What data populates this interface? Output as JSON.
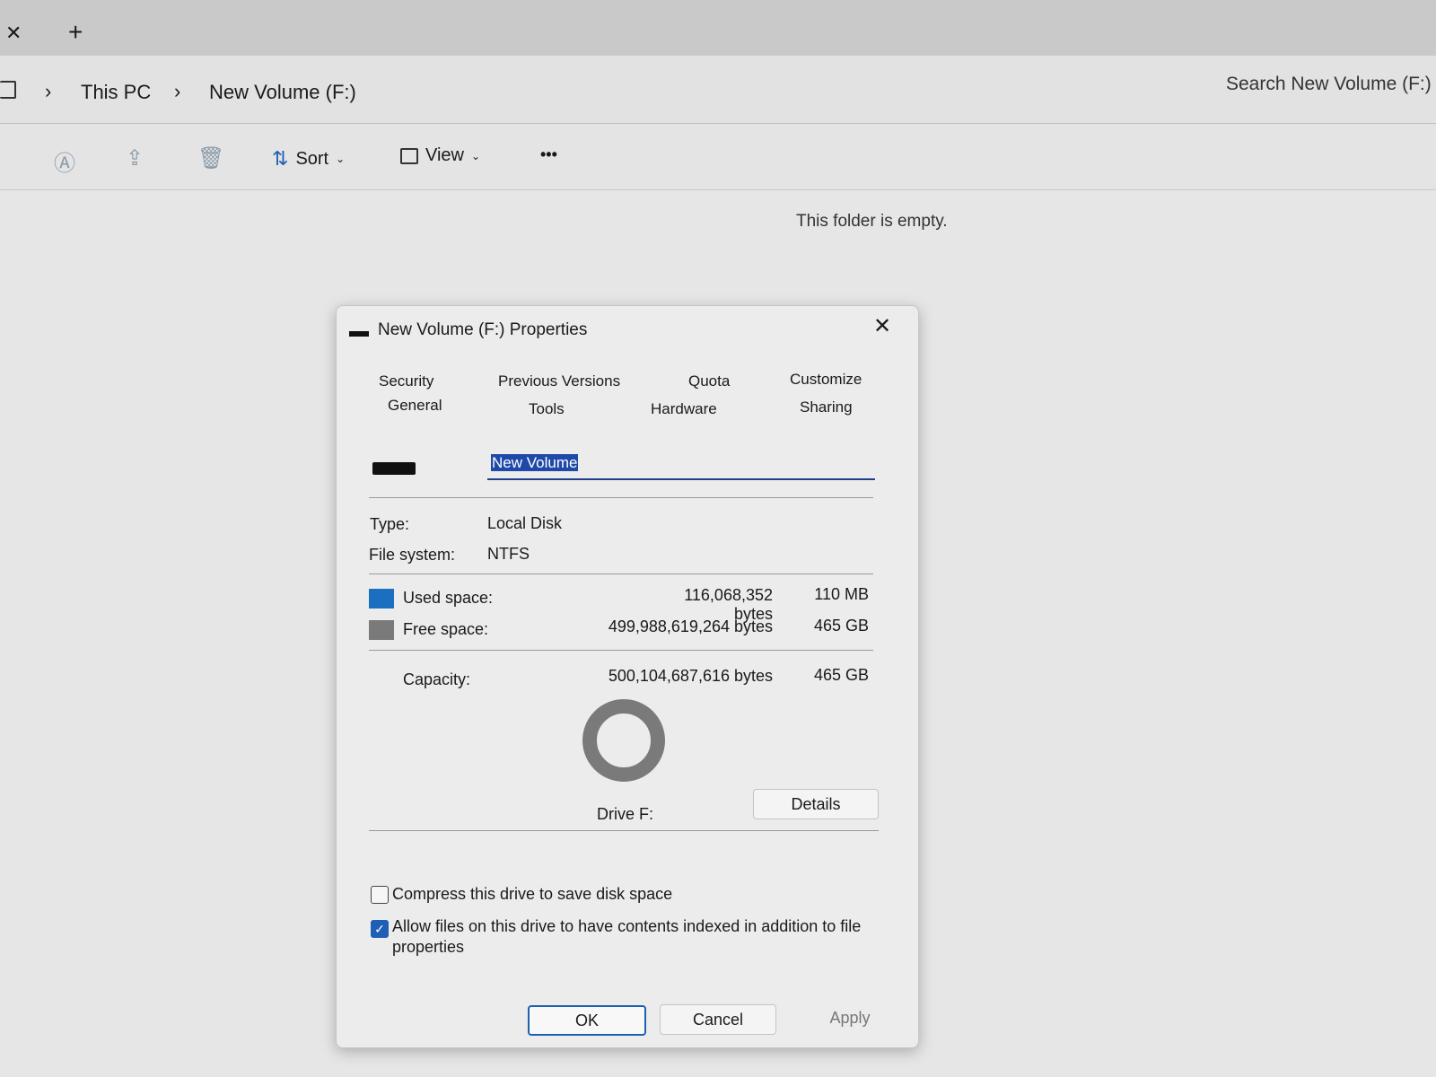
{
  "explorer": {
    "breadcrumb": [
      "This PC",
      "New Volume (F:)"
    ],
    "search_placeholder": "Search New Volume (F:)",
    "toolbar": {
      "sort_label": "Sort",
      "view_label": "View",
      "more_label": "•••"
    },
    "empty_message": "This folder is empty."
  },
  "dialog": {
    "title": "New Volume (F:) Properties",
    "tabs_row1": [
      "Security",
      "Previous Versions",
      "Quota",
      "Customize"
    ],
    "tabs_row2": [
      "General",
      "Tools",
      "Hardware",
      "Sharing"
    ],
    "volume_name": "New Volume",
    "type_label": "Type:",
    "type_value": "Local Disk",
    "fs_label": "File system:",
    "fs_value": "NTFS",
    "used_label": "Used space:",
    "used_bytes": "116,068,352 bytes",
    "used_size": "110 MB",
    "free_label": "Free space:",
    "free_bytes": "499,988,619,264 bytes",
    "free_size": "465 GB",
    "capacity_label": "Capacity:",
    "capacity_bytes": "500,104,687,616 bytes",
    "capacity_size": "465 GB",
    "drive_label": "Drive F:",
    "details_label": "Details",
    "compress_label": "Compress this drive to save disk space",
    "compress_checked": false,
    "index_label": "Allow files on this drive to have contents indexed in addition to file properties",
    "index_checked": true,
    "ok_label": "OK",
    "cancel_label": "Cancel",
    "apply_label": "Apply",
    "used_color": "#1a6fc0",
    "free_color": "#7a7a7a",
    "used_value": 116068352,
    "free_value": 499988619264
  }
}
